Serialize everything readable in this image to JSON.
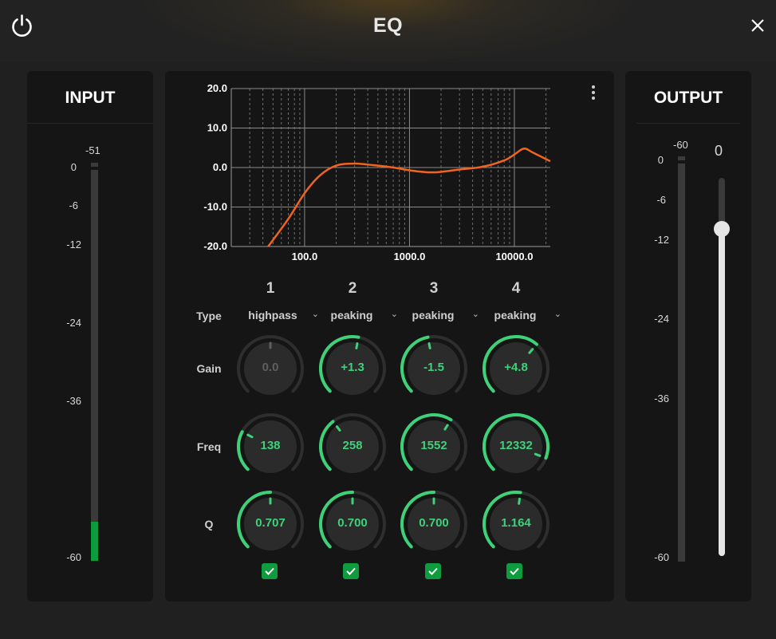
{
  "window": {
    "title": "EQ",
    "power_icon": "power-icon",
    "close_icon": "close-icon"
  },
  "input": {
    "title": "INPUT",
    "peak": "-51",
    "scale": [
      "0",
      "-6",
      "-12",
      "-24",
      "-36",
      "-60"
    ],
    "level_fraction": 0.1
  },
  "output": {
    "title": "OUTPUT",
    "peak": "-60",
    "scale": [
      "0",
      "-6",
      "-12",
      "-24",
      "-36",
      "-60"
    ],
    "gain_value": "0",
    "gain_fraction": 0.865,
    "level_fraction": 0
  },
  "graph": {
    "y_ticks": [
      "20.0",
      "10.0",
      "0.0",
      "-10.0",
      "-20.0"
    ],
    "x_ticks": [
      "100.0",
      "1000.0",
      "10000.0"
    ],
    "curve_color": "#f0641e",
    "ylim": [
      -20,
      20
    ],
    "xlim_hz": [
      20,
      22000
    ],
    "curve": [
      [
        45,
        -20
      ],
      [
        70,
        -13
      ],
      [
        100,
        -6.5
      ],
      [
        140,
        -2
      ],
      [
        200,
        0.5
      ],
      [
        300,
        1
      ],
      [
        450,
        0.6
      ],
      [
        700,
        0
      ],
      [
        1000,
        -0.7
      ],
      [
        1500,
        -1.2
      ],
      [
        2000,
        -1.1
      ],
      [
        3000,
        -0.5
      ],
      [
        5000,
        0.2
      ],
      [
        8000,
        1.8
      ],
      [
        10000,
        3.3
      ],
      [
        12332,
        4.8
      ],
      [
        15000,
        3.8
      ],
      [
        22000,
        1.6
      ]
    ]
  },
  "more_icon": "more-vertical-icon",
  "labels": {
    "type": "Type",
    "gain": "Gain",
    "freq": "Freq",
    "q": "Q"
  },
  "bands": [
    {
      "number": "1",
      "type": "highpass",
      "gain": "0.0",
      "freq": "138",
      "q": "0.707",
      "enabled": true,
      "gain_fraction": 0.5,
      "freq_fraction": 0.27,
      "q_fraction": 0.5,
      "gain_active": false
    },
    {
      "number": "2",
      "type": "peaking",
      "gain": "+1.3",
      "freq": "258",
      "q": "0.700",
      "enabled": true,
      "gain_fraction": 0.54,
      "freq_fraction": 0.36,
      "q_fraction": 0.5,
      "gain_active": true
    },
    {
      "number": "3",
      "type": "peaking",
      "gain": "-1.5",
      "freq": "1552",
      "q": "0.700",
      "enabled": true,
      "gain_fraction": 0.46,
      "freq_fraction": 0.62,
      "q_fraction": 0.5,
      "gain_active": true
    },
    {
      "number": "4",
      "type": "peaking",
      "gain": "+4.8",
      "freq": "12332",
      "q": "1.164",
      "enabled": true,
      "gain_fraction": 0.65,
      "freq_fraction": 0.91,
      "q_fraction": 0.53,
      "gain_active": true
    }
  ],
  "colors": {
    "accent_green": "#3fd17a",
    "meter_green": "#0e9b3c",
    "curve_orange": "#f0641e"
  }
}
